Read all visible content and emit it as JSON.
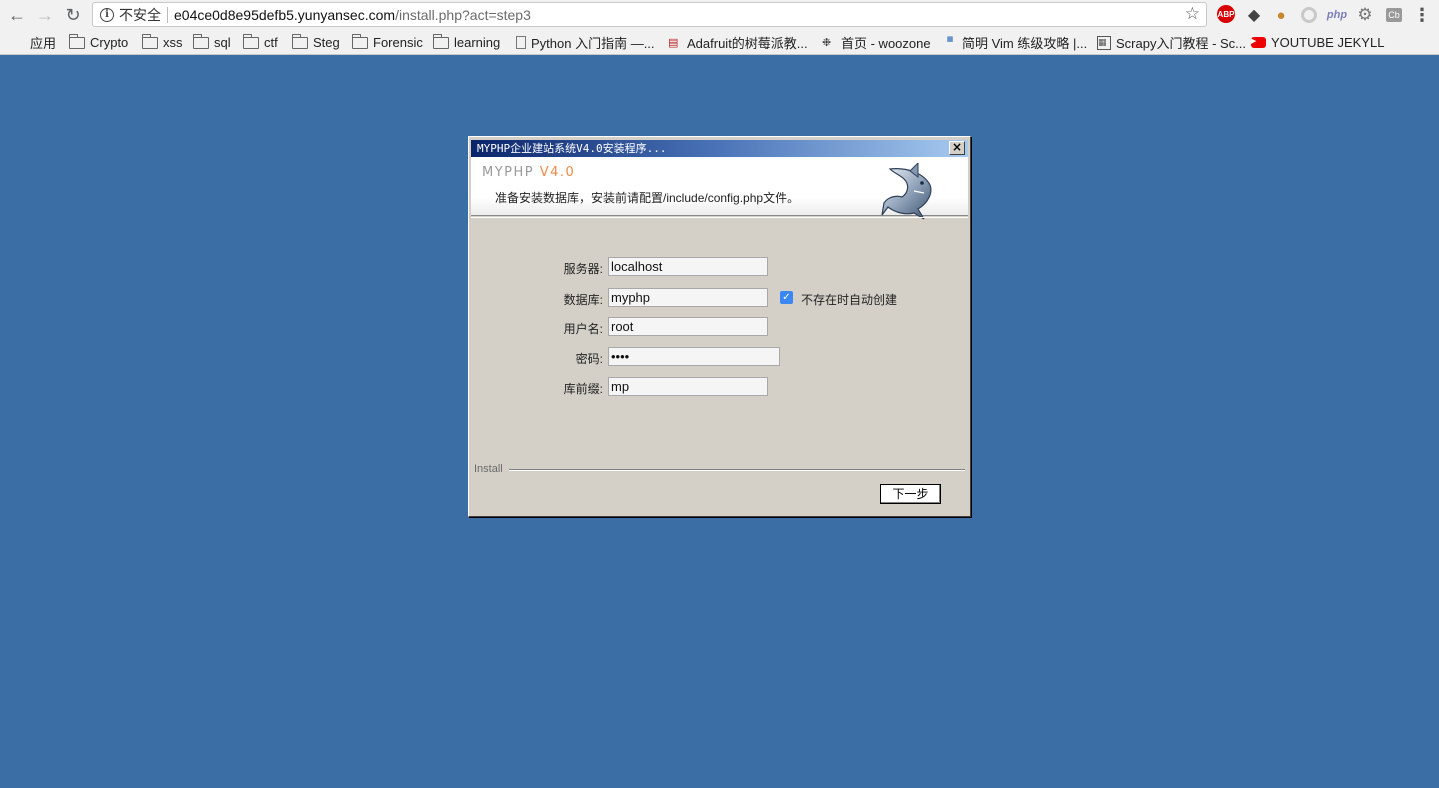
{
  "browser": {
    "insecure_label": "不安全",
    "url_host": "e04ce0d8e95defb5.yunyansec.com",
    "url_path": "/install.php?act=step3",
    "extensions": {
      "abp": "ABP",
      "php": "php",
      "cb": "Cb"
    }
  },
  "bookmarks": {
    "apps": "应用",
    "crypto": "Crypto",
    "xss": "xss",
    "sql": "sql",
    "ctf": "ctf",
    "steg": "Steg",
    "forensic": "Forensic",
    "learning": "learning",
    "python": "Python 入门指南 —...",
    "adafruit": "Adafruit的树莓派教...",
    "woozone": "首页 - woozone",
    "vim": "简明 Vim 练级攻略 |...",
    "scrapy": "Scrapy入门教程 - Sc...",
    "youtube": "YOUTUBE JEKYLL"
  },
  "dialog": {
    "title": "MYPHP企业建站系统V4.0安装程序...",
    "close_label": "×",
    "logo_name": "MYPHP",
    "logo_version": "V4.0",
    "description": "准备安装数据库，安装前请配置/include/config.php文件。",
    "fields": {
      "server": {
        "label": "服务器:",
        "value": "localhost"
      },
      "database": {
        "label": "数据库:",
        "value": "myphp"
      },
      "username": {
        "label": "用户名:",
        "value": "root"
      },
      "password": {
        "label": "密码:",
        "value": "root"
      },
      "prefix": {
        "label": "库前缀:",
        "value": "mp"
      }
    },
    "auto_create_label": "不存在时自动创建",
    "auto_create_checked": true,
    "section_label": "Install",
    "next_label": "下一步"
  },
  "colors": {
    "desktop": "#3c6ea6",
    "dialog_face": "#d4d0c8",
    "title_start": "#0a246a",
    "title_end": "#a6caf0",
    "logo_accent": "#ee8a48"
  }
}
